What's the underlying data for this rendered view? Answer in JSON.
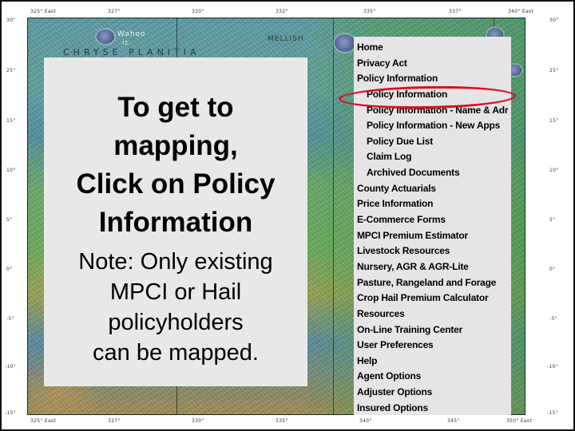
{
  "slide": {
    "instruction": {
      "title": "To get to mapping, Click on Policy Information",
      "title_lines": [
        "To get to",
        "mapping,",
        "Click on Policy",
        "Information"
      ],
      "note_lines": [
        "Note: Only existing",
        "MPCI or Hail",
        "policyholders",
        "can be mapped."
      ]
    },
    "highlight": {
      "target": "Policy Information",
      "color": "#d8121c"
    }
  },
  "menu": {
    "items": [
      {
        "label": "Home",
        "level": 0
      },
      {
        "label": "Privacy Act",
        "level": 0
      },
      {
        "label": "Policy Information",
        "level": 0
      },
      {
        "label": "Policy Information",
        "level": 1,
        "highlighted": true
      },
      {
        "label": "Policy Information - Name & Adr",
        "level": 1
      },
      {
        "label": "Policy Information - New Apps",
        "level": 1
      },
      {
        "label": "Policy Due List",
        "level": 1
      },
      {
        "label": "Claim Log",
        "level": 1
      },
      {
        "label": "Archived Documents",
        "level": 1
      },
      {
        "label": "County Actuarials",
        "level": 0
      },
      {
        "label": "Price Information",
        "level": 0
      },
      {
        "label": "E-Commerce Forms",
        "level": 0
      },
      {
        "label": "MPCI Premium Estimator",
        "level": 0
      },
      {
        "label": "Livestock Resources",
        "level": 0
      },
      {
        "label": "Nursery, AGR & AGR-Lite",
        "level": 0
      },
      {
        "label": "Pasture, Rangeland and Forage",
        "level": 0
      },
      {
        "label": "Crop Hail Premium Calculator",
        "level": 0
      },
      {
        "label": "Resources",
        "level": 0
      },
      {
        "label": "On-Line Training Center",
        "level": 0
      },
      {
        "label": "User Preferences",
        "level": 0
      },
      {
        "label": "Help",
        "level": 0
      },
      {
        "label": "Agent Options",
        "level": 0
      },
      {
        "label": "Adjuster Options",
        "level": 0
      },
      {
        "label": "Insured Options",
        "level": 0
      }
    ]
  },
  "map": {
    "labels": {
      "region": "CHRYSE PLANITIA",
      "crater_1": "Wahoo",
      "crater_1_sub": "ic",
      "crater_2": "MELLISH"
    },
    "top_ticks": [
      "325° East",
      "327°",
      "330°",
      "332°",
      "335°",
      "337°",
      "340° East"
    ],
    "bottom_ticks": [
      "325° East",
      "327°",
      "330°",
      "335°",
      "340°",
      "345°",
      "350° East"
    ],
    "left_ticks": [
      "30°",
      "25°",
      "15°",
      "10°",
      "5°",
      "0°",
      "-5°",
      "-10°",
      "-15°"
    ],
    "right_ticks": [
      "30°",
      "25°",
      "15°",
      "10°",
      "5°",
      "0°",
      "-5°",
      "-10°",
      "-15°"
    ]
  }
}
